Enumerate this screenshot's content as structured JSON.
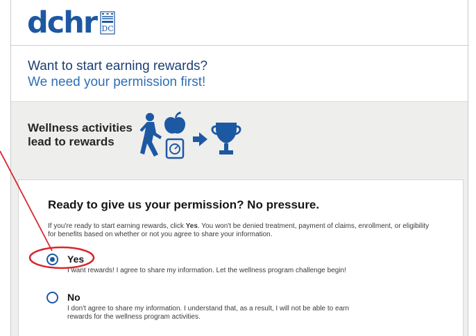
{
  "logo": {
    "text": "dchr",
    "badge_text": "WE ARE DC",
    "color": "#1d58a3"
  },
  "intro": {
    "line1": "Want to start earning rewards?",
    "line2": "We need your permission first!"
  },
  "wellness": {
    "title_line1": "Wellness activities",
    "title_line2": "lead to rewards",
    "icons": [
      "walking-person-icon",
      "apple-icon",
      "scale-icon",
      "arrow-right-icon",
      "trophy-icon"
    ]
  },
  "permission": {
    "title": "Ready to give us your permission? No pressure.",
    "body_pre": "If you're ready to start earning rewards, click ",
    "body_bold": "Yes",
    "body_post": ". You won't be denied treatment, payment of claims, enrollment, or eligibility for benefits based on whether or not you agree to share your information.",
    "options": [
      {
        "label": "Yes",
        "checked": true,
        "description": "I want rewards! I agree to share my information. Let the wellness program challenge begin!"
      },
      {
        "label": "No",
        "checked": false,
        "description": "I don't agree to share my information. I understand that, as a result, I will not be able to earn rewards for the wellness program activities."
      }
    ]
  },
  "colors": {
    "brand_blue": "#1d58a3",
    "annotation_red": "#d8262e",
    "panel_gray": "#eeeeec"
  }
}
